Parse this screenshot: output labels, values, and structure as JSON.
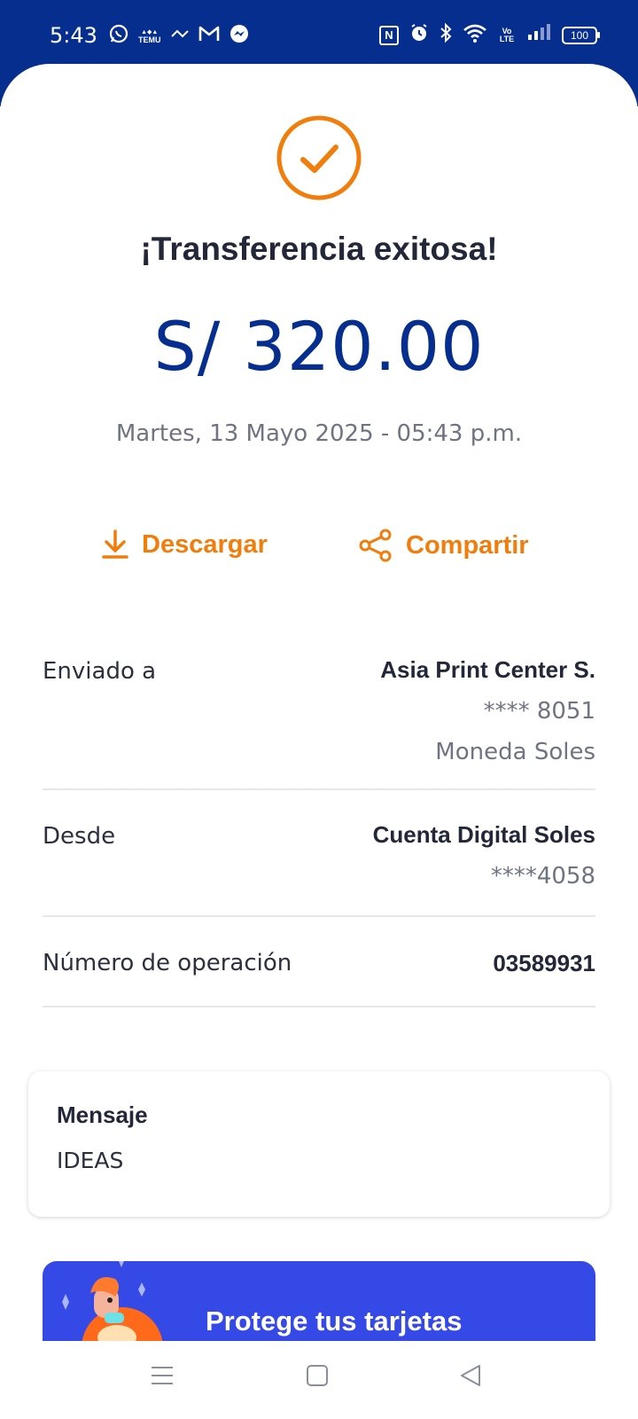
{
  "status_bar": {
    "time": "5:43",
    "temu_label": "TEMU",
    "battery": "100",
    "volte_label": "Vo LTE",
    "nfc_label": "N",
    "icons_left": [
      "whatsapp-icon",
      "temu-icon",
      "bcp-icon",
      "gmail-icon",
      "messenger-icon"
    ],
    "icons_right": [
      "nfc-icon",
      "alarm-icon",
      "bluetooth-icon",
      "wifi-icon",
      "volte-icon",
      "signal-icon",
      "battery-icon"
    ]
  },
  "result": {
    "title": "¡Transferencia exitosa!",
    "amount": "S/ 320.00",
    "datetime": "Martes, 13 Mayo 2025 - 05:43 p.m."
  },
  "actions": {
    "download_label": "Descargar",
    "share_label": "Compartir"
  },
  "details": {
    "sent_to": {
      "label": "Enviado a",
      "name": "Asia Print Center S.",
      "account": "**** 8051",
      "currency": "Moneda Soles"
    },
    "from": {
      "label": "Desde",
      "name": "Cuenta Digital Soles",
      "account": "****4058"
    },
    "operation": {
      "label": "Número de operación",
      "value": "03589931"
    }
  },
  "message": {
    "title": "Mensaje",
    "body": "IDEAS"
  },
  "promo": {
    "title": "Protege tus tarjetas"
  },
  "colors": {
    "brand_blue": "#062e8f",
    "accent_orange": "#f07d0c",
    "promo_blue": "#3449e6"
  }
}
